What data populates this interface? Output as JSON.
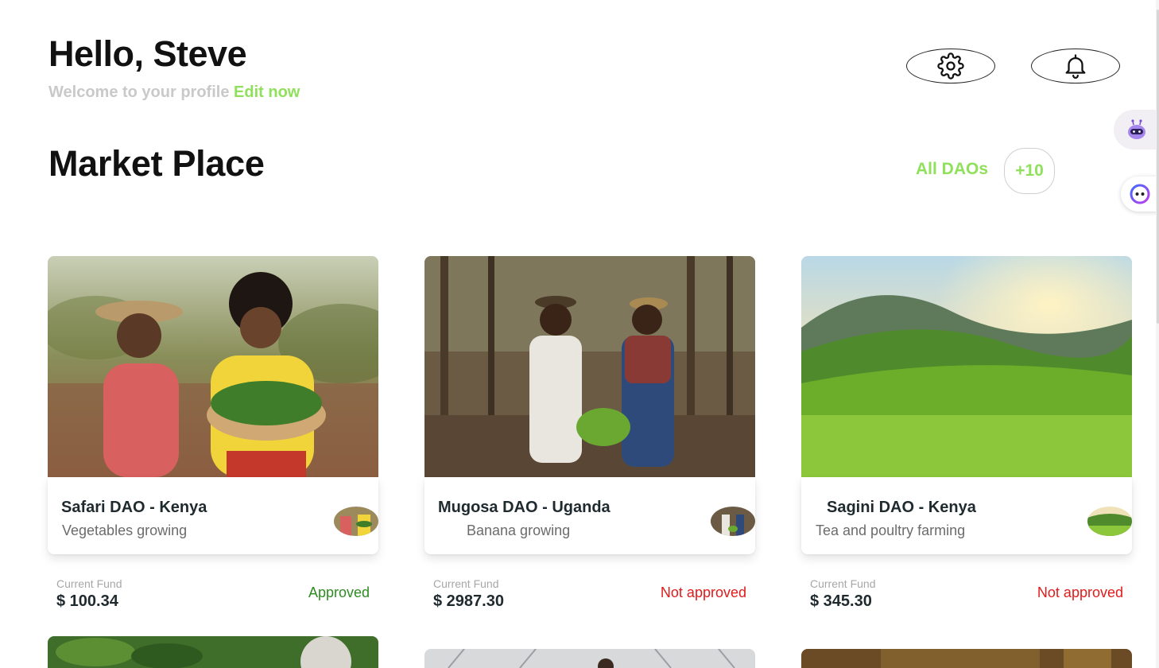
{
  "header": {
    "greeting": "Hello, Steve",
    "welcome_text": "Welcome to your profile",
    "edit_link": "Edit now",
    "settings_icon": "gear-icon",
    "bell_icon": "bell-icon"
  },
  "marketplace": {
    "title": "Market Place",
    "all_daos_label": "All DAOs",
    "more_count": "+10"
  },
  "colors": {
    "accent_green": "#8fe05a",
    "approved_green": "#2e8b22",
    "not_approved_red": "#e01b1b"
  },
  "cards": [
    {
      "name": "Safari DAO - Kenya",
      "description": "Vegetables growing",
      "fund_label": "Current Fund",
      "fund_value": "$ 100.34",
      "status": "Approved"
    },
    {
      "name": "Mugosa DAO - Uganda",
      "description": "Banana growing",
      "fund_label": "Current Fund",
      "fund_value": "$ 2987.30",
      "status": "Not approved"
    },
    {
      "name": "Sagini DAO - Kenya",
      "description": "Tea and poultry farming",
      "fund_label": "Current Fund",
      "fund_value": "$ 345.30",
      "status": "Not approved"
    }
  ],
  "floating": {
    "assistant_icon": "robot-icon",
    "chat_icon": "chat-bot-icon"
  }
}
